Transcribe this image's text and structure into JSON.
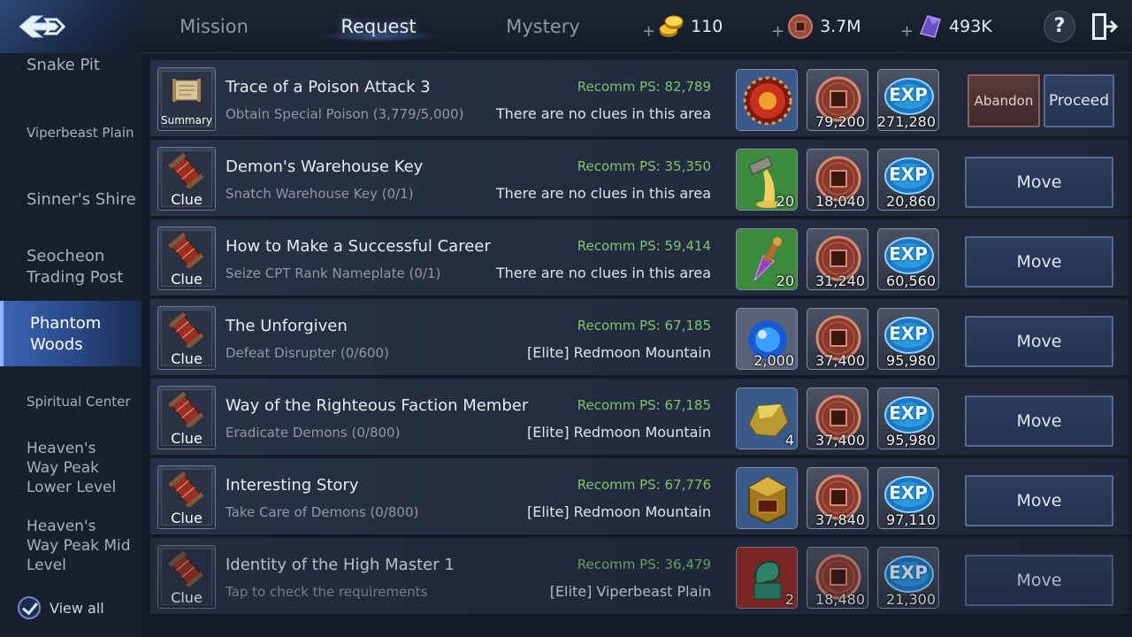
{
  "tabs": [
    {
      "label": "Mission",
      "active": false
    },
    {
      "label": "Request",
      "active": true
    },
    {
      "label": "Mystery",
      "active": false
    }
  ],
  "currencies": [
    {
      "name": "gold-coins",
      "value": "110"
    },
    {
      "name": "copper-coin",
      "value": "3.7M"
    },
    {
      "name": "purple-crystal",
      "value": "493K"
    }
  ],
  "help_label": "?",
  "sidebar": {
    "items": [
      {
        "label": "Snake Pit"
      },
      {
        "label": "Viperbeast Plain"
      },
      {
        "label": "Sinner's Shire"
      },
      {
        "label": "Seocheon Trading Post"
      },
      {
        "label": "Phantom Woods",
        "active": true
      },
      {
        "label": "Spiritual Center"
      },
      {
        "label": "Heaven's Way Peak Lower Level"
      },
      {
        "label": "Heaven's Way Peak Mid Level"
      }
    ],
    "view_all": "View all"
  },
  "quests": [
    {
      "icon_label": "Summary",
      "icon": "scroll-icon",
      "title": "Trace of a Poison Attack 3",
      "subtitle": "Obtain Special Poison (3,779/5,000)",
      "recomm": "Recomm PS: 82,789",
      "location": "There are no clues in this area",
      "reward_item": {
        "icon": "red-orb-icon",
        "count": ""
      },
      "coin": "79,200",
      "exp": "271,280",
      "actions": [
        "Abandon",
        "Proceed"
      ]
    },
    {
      "icon_label": "Clue",
      "icon": "clue-scroll-icon",
      "title": "Demon's Warehouse Key",
      "subtitle": "Snatch Warehouse Key (0/1)",
      "recomm": "Recomm PS: 35,350",
      "location": "There are no clues in this area",
      "reward_item": {
        "icon": "pouring-vessel-icon",
        "count": "20"
      },
      "coin": "18,040",
      "exp": "20,860",
      "actions": [
        "Move"
      ]
    },
    {
      "icon_label": "Clue",
      "icon": "clue-scroll-icon",
      "title": "How to Make a Successful Career",
      "subtitle": "Seize CPT Rank Nameplate (0/1)",
      "recomm": "Recomm PS: 59,414",
      "location": "There are no clues in this area",
      "reward_item": {
        "icon": "purple-crystal-tool-icon",
        "count": "20"
      },
      "coin": "31,240",
      "exp": "60,560",
      "actions": [
        "Move"
      ]
    },
    {
      "icon_label": "Clue",
      "icon": "clue-scroll-icon",
      "title": "The Unforgiven",
      "subtitle": "Defeat Disrupter (0/600)",
      "recomm": "Recomm PS: 67,185",
      "location": "[Elite] Redmoon Mountain",
      "reward_item": {
        "icon": "blue-orb-icon",
        "count": "2,000"
      },
      "coin": "37,400",
      "exp": "95,980",
      "actions": [
        "Move"
      ]
    },
    {
      "icon_label": "Clue",
      "icon": "clue-scroll-icon",
      "title": "Way of the Righteous Faction Member",
      "subtitle": "Eradicate Demons (0/800)",
      "recomm": "Recomm PS: 67,185",
      "location": "[Elite] Redmoon Mountain",
      "reward_item": {
        "icon": "gold-ore-icon",
        "count": "4"
      },
      "coin": "37,400",
      "exp": "95,980",
      "actions": [
        "Move"
      ]
    },
    {
      "icon_label": "Clue",
      "icon": "clue-scroll-icon",
      "title": "Interesting Story",
      "subtitle": "Take Care of Demons (0/800)",
      "recomm": "Recomm PS: 67,776",
      "location": "[Elite] Redmoon Mountain",
      "reward_item": {
        "icon": "treasure-box-icon",
        "count": ""
      },
      "coin": "37,840",
      "exp": "97,110",
      "actions": [
        "Move"
      ]
    },
    {
      "icon_label": "Clue",
      "icon": "clue-scroll-icon",
      "title": "Identity of the High Master 1",
      "subtitle": "Tap to check the requirements",
      "recomm": "Recomm PS: 36,479",
      "location": "[Elite] Viperbeast Plain",
      "reward_item": {
        "icon": "jade-dragon-seal-icon",
        "count": "2"
      },
      "coin": "18,480",
      "exp": "21,300",
      "actions": [
        "Move"
      ],
      "dimmed": true
    }
  ],
  "exp_label": "EXP",
  "colors": {
    "recomm_green": "#7fc56a",
    "active_side": "#3c64b4",
    "button_border": "#56698f"
  }
}
